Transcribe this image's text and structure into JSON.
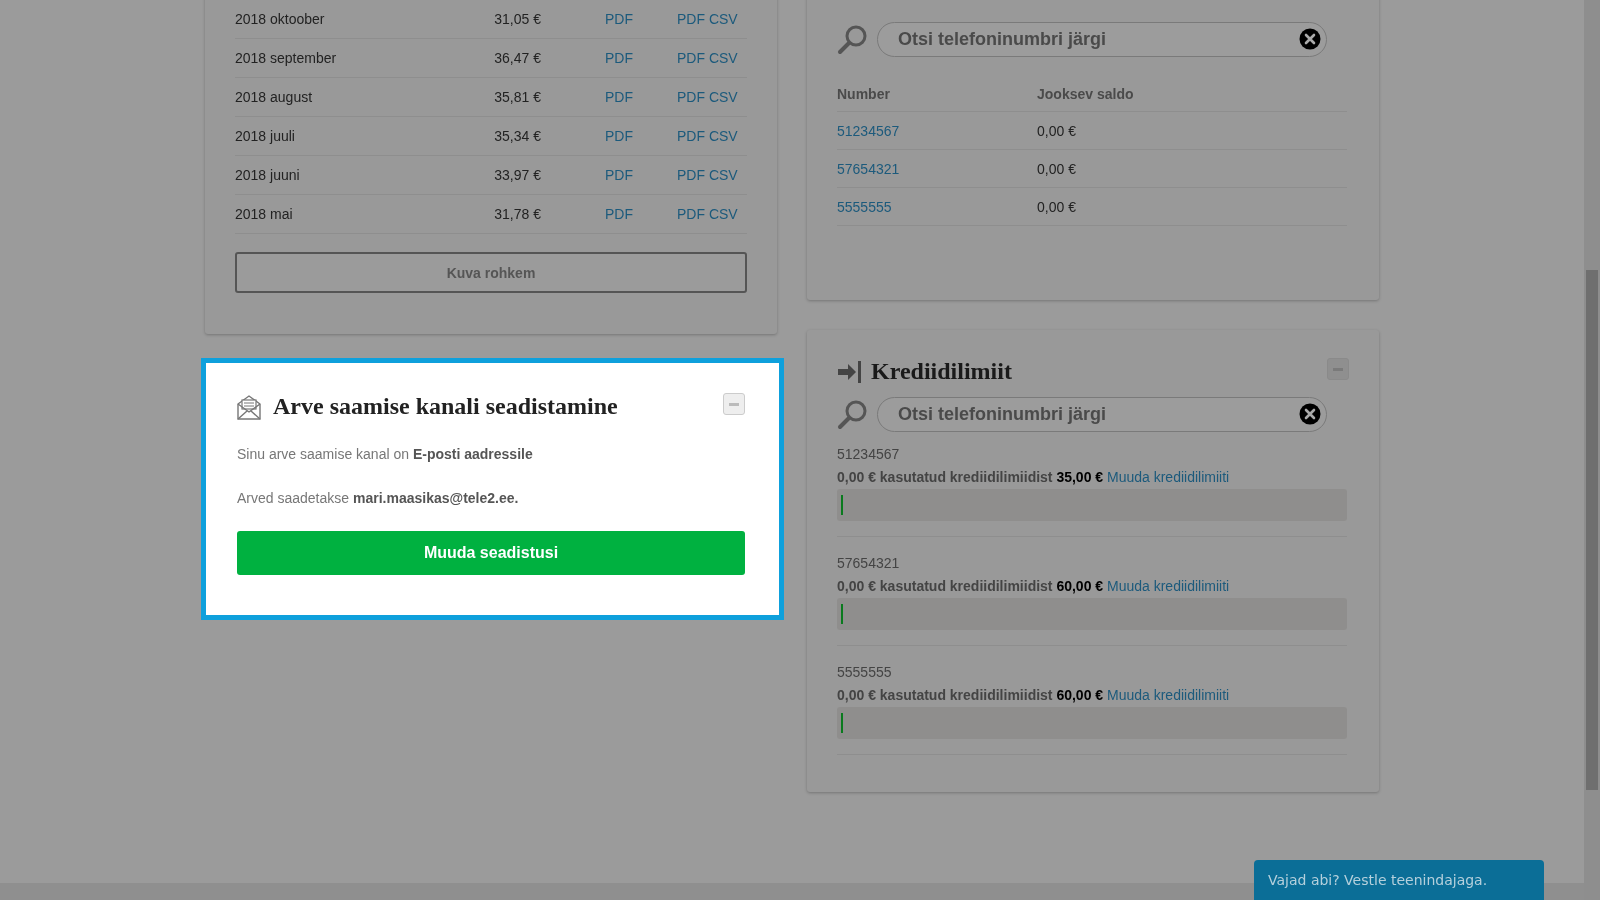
{
  "invoices": {
    "rows": [
      {
        "period": "2018 oktoober",
        "amount": "31,05 €",
        "pdf": "PDF",
        "pdf_csv": "PDF CSV"
      },
      {
        "period": "2018 september",
        "amount": "36,47 €",
        "pdf": "PDF",
        "pdf_csv": "PDF CSV"
      },
      {
        "period": "2018 august",
        "amount": "35,81 €",
        "pdf": "PDF",
        "pdf_csv": "PDF CSV"
      },
      {
        "period": "2018 juuli",
        "amount": "35,34 €",
        "pdf": "PDF",
        "pdf_csv": "PDF CSV"
      },
      {
        "period": "2018 juuni",
        "amount": "33,97 €",
        "pdf": "PDF",
        "pdf_csv": "PDF CSV"
      },
      {
        "period": "2018 mai",
        "amount": "31,78 €",
        "pdf": "PDF",
        "pdf_csv": "PDF CSV"
      }
    ],
    "more_button": "Kuva rohkem"
  },
  "balance": {
    "search": {
      "placeholder": "Otsi telefoninumbri järgi"
    },
    "columns": [
      "Number",
      "Jooksev saldo"
    ],
    "rows": [
      {
        "number": "51234567",
        "balance": "0,00 €"
      },
      {
        "number": "57654321",
        "balance": "0,00 €"
      },
      {
        "number": "5555555",
        "balance": "0,00 €"
      }
    ]
  },
  "billing_channel": {
    "title": "Arve saamise kanali seadistamine",
    "channel_text": "Sinu arve saamise kanal on **E-posti aadressile**",
    "email_text": "Arved saadetakse **mari.maasikas@tele2.ee.**",
    "button": "Muuda seadistusi"
  },
  "credit_limits": {
    "title": "Krediidilimiit",
    "search": {
      "placeholder": "Otsi telefoninumbri järgi"
    },
    "items": [
      {
        "number": "51234567",
        "usage": "0,00 € kasutatud krediidilimiidist **35,00 €**",
        "link": "Muuda krediidilimiiti",
        "level": 0
      },
      {
        "number": "57654321",
        "usage": "0,00 € kasutatud krediidilimiidist **60,00 €**",
        "link": "Muuda krediidilimiiti",
        "level": 0
      },
      {
        "number": "5555555",
        "usage": "0,00 € kasutatud krediidilimiidist **60,00 €**",
        "link": "Muuda krediidilimiiti",
        "level": 0
      }
    ]
  },
  "chat_button": "Vajad abi? Vestle teenindajaga."
}
